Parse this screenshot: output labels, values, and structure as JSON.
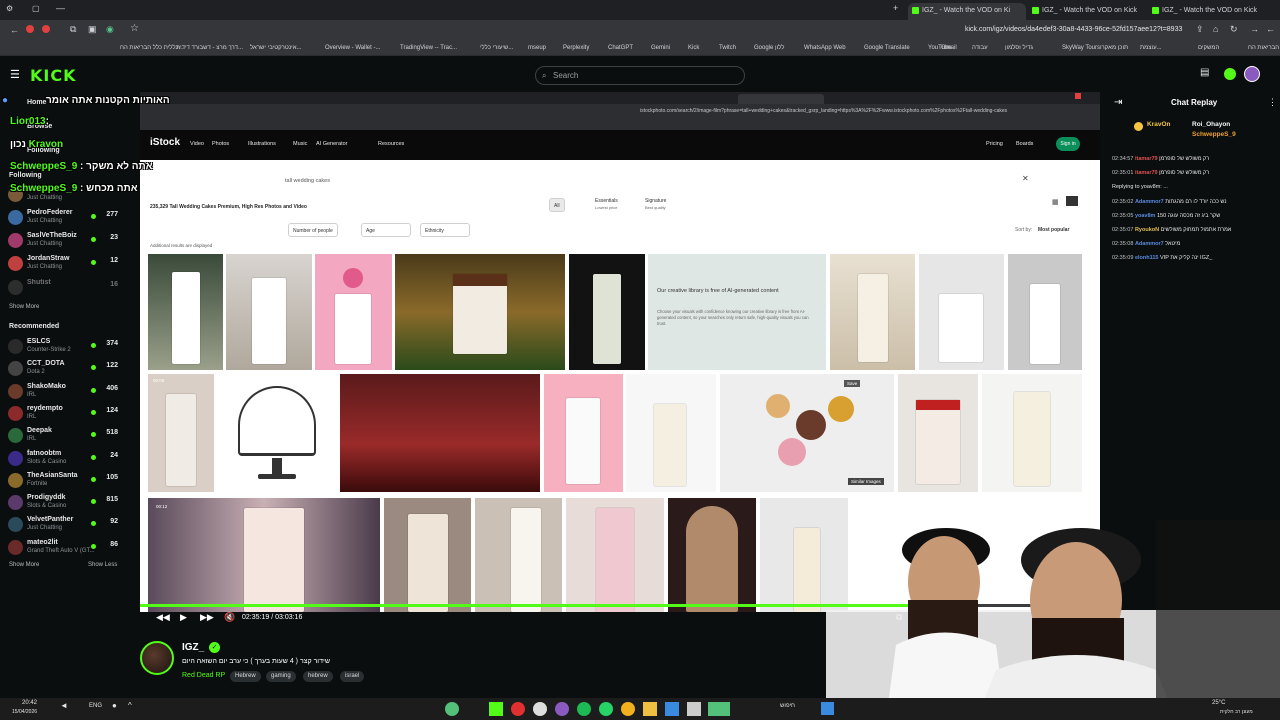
{
  "browser": {
    "tabs": [
      {
        "label": "IGZ_ - Watch the VOD on Ki",
        "active": true
      },
      {
        "label": "IGZ_ - Watch the VOD on Kick",
        "active": false
      },
      {
        "label": "IGZ_ - Watch the VOD on Kick",
        "active": false
      }
    ],
    "url": "kick.com/igz/videos/da4edef3-30a8-4433-96ce-52fd157aee12?t=8933",
    "bookmarks": [
      "כללית כלל הבריאות הח...",
      "דרך מרצ - דשבורד דידית...",
      "אינטרקטיבי ישראל...",
      "Overview - Wallet -...",
      "TradingView -- Trac...",
      "שיעורי כללי...",
      "mseup",
      "Perplexity",
      "ChatGPT",
      "Gemini",
      "Kick",
      "Twitch",
      "Google ללון",
      "WhatsApp Web",
      "Google Translate",
      "YouTube",
      "Gmail",
      "עבודה",
      "SkyWay Tours",
      "תוכן מאקרו",
      "גדיל וסלמון",
      "עוצמת...",
      "המשקים"
    ]
  },
  "kick": {
    "logo": "KICK",
    "search_placeholder": "Search"
  },
  "sidebar": {
    "home": "Home",
    "browse": "Browse",
    "following": "Following",
    "following_list": [
      {
        "name": "Gxsfdsa",
        "cat": "Just Chatting",
        "count": "",
        "color": "#7a5a3a"
      },
      {
        "name": "PedroFederer",
        "cat": "Just Chatting",
        "count": "277",
        "color": "#3a6aa0"
      },
      {
        "name": "SaslVeTheBoiz",
        "cat": "Just Chatting",
        "count": "23",
        "color": "#a03a6a"
      },
      {
        "name": "JordanStraw",
        "cat": "Just Chatting",
        "count": "12",
        "color": "#c04040"
      },
      {
        "name": "Shutist",
        "cat": "",
        "count": "16",
        "color": "#555555"
      }
    ],
    "show_more": "Show More",
    "recommended": "Recommended",
    "recommended_list": [
      {
        "name": "ESLCS",
        "cat": "Counter-Strike 2",
        "count": "374",
        "color": "#2a2a2a"
      },
      {
        "name": "CCT_DOTA",
        "cat": "Dota 2",
        "count": "122",
        "color": "#444444"
      },
      {
        "name": "ShakoMako",
        "cat": "IRL",
        "count": "406",
        "color": "#6a3a2a"
      },
      {
        "name": "reydempto",
        "cat": "IRL",
        "count": "124",
        "color": "#8a2a2a"
      },
      {
        "name": "Deepak",
        "cat": "IRL",
        "count": "518",
        "color": "#2a6a3a"
      },
      {
        "name": "fatnoobtm",
        "cat": "Slots & Casino",
        "count": "24",
        "color": "#3a2a8a"
      },
      {
        "name": "TheAsianSanta",
        "cat": "Fortnite",
        "count": "105",
        "color": "#8a6a2a"
      },
      {
        "name": "Prodigyddk",
        "cat": "Slots & Casino",
        "count": "815",
        "color": "#5a3a6a"
      },
      {
        "name": "VelvetPanther",
        "cat": "Just Chatting",
        "count": "92",
        "color": "#2a4a5a"
      },
      {
        "name": "mateo2lit",
        "cat": "Grand Theft Auto V (GT...",
        "count": "86",
        "color": "#6a2a2a"
      }
    ],
    "show_more_2": "Show More",
    "show_less": "Show Less"
  },
  "overlay": [
    {
      "user": "Lior013",
      "text": ":"
    },
    {
      "user": "Kravon",
      "text": "נכון"
    },
    {
      "user": "SchweppeS_9",
      "text": "אתה לא משקר"
    },
    {
      "user": "SchweppeS_9",
      "text": "אתה מכחש"
    }
  ],
  "overlay_top": "האותיות הקטנות אתה אומר",
  "istock": {
    "logo": "iStock",
    "nav": [
      "Video",
      "Photos",
      "Illustrations",
      "Music",
      "AI Generator",
      "Resources"
    ],
    "right_nav": [
      "Pricing",
      "Boards",
      "Sign in"
    ],
    "search_value": "tall wedding cakes",
    "result_title": "235,329 Tall Wedding Cakes Premium, High Res Photos and Video",
    "filters": [
      "Number of people",
      "Age",
      "Ethnicity"
    ],
    "tabs": [
      "All",
      "Essentials",
      "Signature"
    ],
    "tab_sub": [
      "Lowest price",
      "Best quality"
    ],
    "sort_label": "Sort by:",
    "sort_value": "Most popular",
    "ai_note_title": "Our creative library is free of AI-generated content",
    "ai_note_body": "Choose your visuals with confidence knowing our creative library is free from AI-generated content, so your searches only return safe, high-quality visuals you can trust.",
    "additional": "Additional results are displayed",
    "similar": "Similar Images",
    "save": "Save"
  },
  "player": {
    "time": "02:35:19 / 03:03:16",
    "progress_fraction": 0.84
  },
  "chat": {
    "title": "Chat Replay",
    "pinned_users": [
      {
        "name": "KravOn",
        "color": "#f5c542"
      },
      {
        "name": "Roi_Ohayon",
        "color": "#f5f5f5"
      },
      {
        "name": "SchweppeS_9",
        "color": "#f0a030"
      }
    ],
    "messages": [
      {
        "ts": "02:34:57",
        "user": "itamar79",
        "color": "#e05050",
        "text": "רק משולש של סופרמן"
      },
      {
        "ts": "02:35:01",
        "user": "itamar79",
        "color": "#e05050",
        "text": "רק משולש של סופרמן"
      },
      {
        "ts": "",
        "user": "",
        "color": "#9aa0a4",
        "text": "Replying to yoav8m: ..."
      },
      {
        "ts": "02:35:02",
        "user": "Adammor7",
        "color": "#5a8ae0",
        "text": "נש ככה יורד לו רם מהגתות"
      },
      {
        "ts": "02:35:05",
        "user": "yoav8m",
        "color": "#5a8ae0",
        "text": "שקר ביג זה מכסה עוגה 150"
      },
      {
        "ts": "02:35:07",
        "user": "RyoukoN",
        "color": "#e0c050",
        "text": "אמרת אתמול תמחוק משולשים"
      },
      {
        "ts": "02:35:08",
        "user": "Adammor7",
        "color": "#5a8ae0",
        "text": "מיטאל"
      },
      {
        "ts": "02:35:09",
        "user": "elonh115",
        "color": "#5a8ae0",
        "text": "VIP ינה קליק את IGZ_"
      }
    ]
  },
  "stream": {
    "name": "IGZ_",
    "title": "שידור קצר ( 4 שעות בערך ) כי ערב יום השואה היום",
    "category": "Red Dead RP",
    "tags": [
      "Hebrew",
      "gaming",
      "hebrew",
      "israel"
    ]
  },
  "taskbar": {
    "time": "20:42",
    "date": "15/04/2026",
    "lang": "ENG",
    "weather": "25°C",
    "weather_sub": "מעונן רב חלקית",
    "search": "חיפוש"
  },
  "colors": {
    "kick_green": "#53fc18",
    "bg": "#0b0e0f"
  }
}
